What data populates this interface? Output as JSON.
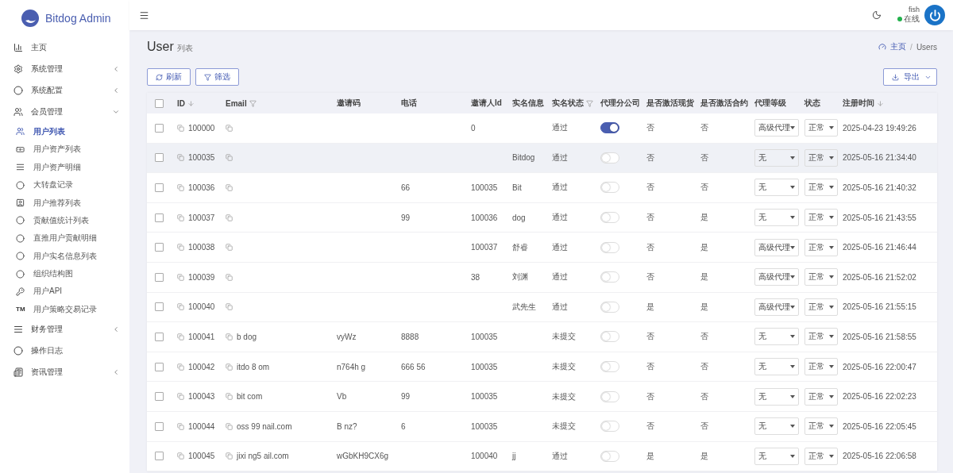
{
  "brand": {
    "name": "Bitdog Admin"
  },
  "sidebar": {
    "items": [
      {
        "label": "主页"
      },
      {
        "label": "系统管理",
        "expanded": false
      },
      {
        "label": "系统配置",
        "expanded": false
      },
      {
        "label": "会员管理",
        "expanded": true,
        "children": [
          {
            "label": "用户列表",
            "selected": true
          },
          {
            "label": "用户资产列表",
            "selected": false
          },
          {
            "label": "用户资产明细",
            "selected": false
          },
          {
            "label": "大转盘记录",
            "selected": false
          },
          {
            "label": "用户推荐列表",
            "selected": false
          },
          {
            "label": "贡献值统计列表",
            "selected": false
          },
          {
            "label": "直推用户贡献明细",
            "selected": false
          },
          {
            "label": "用户实名信息列表",
            "selected": false
          },
          {
            "label": "组织结构图",
            "selected": false
          },
          {
            "label": "用户API",
            "selected": false
          },
          {
            "label": "用户策略交易记录",
            "selected": false,
            "glyph": "TM"
          }
        ]
      },
      {
        "label": "财务管理",
        "expanded": false
      },
      {
        "label": "操作日志"
      },
      {
        "label": "资讯管理",
        "expanded": false
      }
    ]
  },
  "user": {
    "name": "fish",
    "status": "在线"
  },
  "page": {
    "title": "User",
    "subtitle": "列表",
    "breadcrumb": [
      "主页",
      "Users"
    ],
    "breadcrumb_separator": "/"
  },
  "toolbar": {
    "buttons": [
      "刷新",
      "筛选"
    ],
    "export": "导出"
  },
  "table": {
    "all_checked": false,
    "columns": [
      {
        "label": "ID",
        "kind": "sort"
      },
      {
        "label": "Email",
        "kind": "filter"
      },
      {
        "label": "邀请码",
        "kind": "plain"
      },
      {
        "label": "电话",
        "kind": "plain"
      },
      {
        "label": "邀请人Id",
        "kind": "plain"
      },
      {
        "label": "实名信息",
        "kind": "plain"
      },
      {
        "label": "实名状态",
        "kind": "filter"
      },
      {
        "label": "代理分公司",
        "kind": "plain"
      },
      {
        "label": "是否激活现货",
        "kind": "plain"
      },
      {
        "label": "是否激活合约",
        "kind": "plain"
      },
      {
        "label": "代理等级",
        "kind": "plain"
      },
      {
        "label": "状态",
        "kind": "plain"
      },
      {
        "label": "注册时间",
        "kind": "sort"
      }
    ],
    "rows": [
      {
        "checked": false,
        "hovered": false,
        "id": "100000",
        "inviter": "0",
        "verify": "通过",
        "branch": true,
        "spot": "否",
        "contract": "否",
        "level": "高级代理",
        "status": "正常",
        "time": "2025-04-23 19:49:26"
      },
      {
        "checked": false,
        "hovered": true,
        "id": "100035",
        "name": "Bitdog",
        "verify": "通过",
        "branch": false,
        "spot": "否",
        "contract": "否",
        "level": "无",
        "status": "正常",
        "time": "2025-05-16 21:34:40"
      },
      {
        "checked": false,
        "hovered": false,
        "id": "100036",
        "phone": "66",
        "inviter": "100035",
        "name": "Bit",
        "verify": "通过",
        "branch": false,
        "spot": "否",
        "contract": "否",
        "level": "无",
        "status": "正常",
        "time": "2025-05-16 21:40:32"
      },
      {
        "checked": false,
        "hovered": false,
        "id": "100037",
        "phone": "99",
        "inviter": "100036",
        "name": "dog",
        "verify": "通过",
        "branch": false,
        "spot": "否",
        "contract": "是",
        "level": "无",
        "status": "正常",
        "time": "2025-05-16 21:43:55"
      },
      {
        "checked": false,
        "hovered": false,
        "id": "100038",
        "inviter": "100037",
        "name": "舒睿",
        "verify": "通过",
        "branch": false,
        "spot": "否",
        "contract": "是",
        "level": "高级代理",
        "status": "正常",
        "time": "2025-05-16 21:46:44"
      },
      {
        "checked": false,
        "hovered": false,
        "id": "100039",
        "inviter": "38",
        "name": "刘渊",
        "verify": "通过",
        "branch": false,
        "spot": "否",
        "contract": "是",
        "level": "高级代理",
        "status": "正常",
        "time": "2025-05-16 21:52:02"
      },
      {
        "checked": false,
        "hovered": false,
        "id": "100040",
        "name": "武先生",
        "verify": "通过",
        "branch": false,
        "spot": "是",
        "contract": "是",
        "level": "高级代理",
        "status": "正常",
        "time": "2025-05-16 21:55:15"
      },
      {
        "checked": false,
        "hovered": false,
        "id": "100041",
        "email": "b dog",
        "code": "vyWz",
        "phone": "8888",
        "inviter": "100035",
        "verify": "未提交",
        "branch": false,
        "spot": "否",
        "contract": "否",
        "level": "无",
        "status": "正常",
        "time": "2025-05-16 21:58:55"
      },
      {
        "checked": false,
        "hovered": false,
        "id": "100042",
        "email": "itdo 8 om",
        "code": "n764h g",
        "phone": "666 56",
        "inviter": "100035",
        "verify": "未提交",
        "branch": false,
        "spot": "否",
        "contract": "否",
        "level": "无",
        "status": "正常",
        "time": "2025-05-16 22:00:47"
      },
      {
        "checked": false,
        "hovered": false,
        "id": "100043",
        "email": "bit com",
        "code": "Vb",
        "phone": "99",
        "inviter": "100035",
        "verify": "未提交",
        "branch": false,
        "spot": "否",
        "contract": "否",
        "level": "无",
        "status": "正常",
        "time": "2025-05-16 22:02:23"
      },
      {
        "checked": false,
        "hovered": false,
        "id": "100044",
        "email": "oss 99 nail.com",
        "code": "B nz?",
        "phone": "6",
        "inviter": "100035",
        "verify": "未提交",
        "branch": false,
        "spot": "否",
        "contract": "否",
        "level": "无",
        "status": "正常",
        "time": "2025-05-16 22:05:45"
      },
      {
        "checked": false,
        "hovered": false,
        "id": "100045",
        "email": "jixi ng5 ail.com",
        "code": "wGbKH9CX6g",
        "inviter": "100040",
        "name": "jj",
        "verify": "通过",
        "branch": false,
        "spot": "是",
        "contract": "是",
        "level": "无",
        "status": "正常",
        "time": "2025-05-16 22:06:58"
      }
    ]
  }
}
